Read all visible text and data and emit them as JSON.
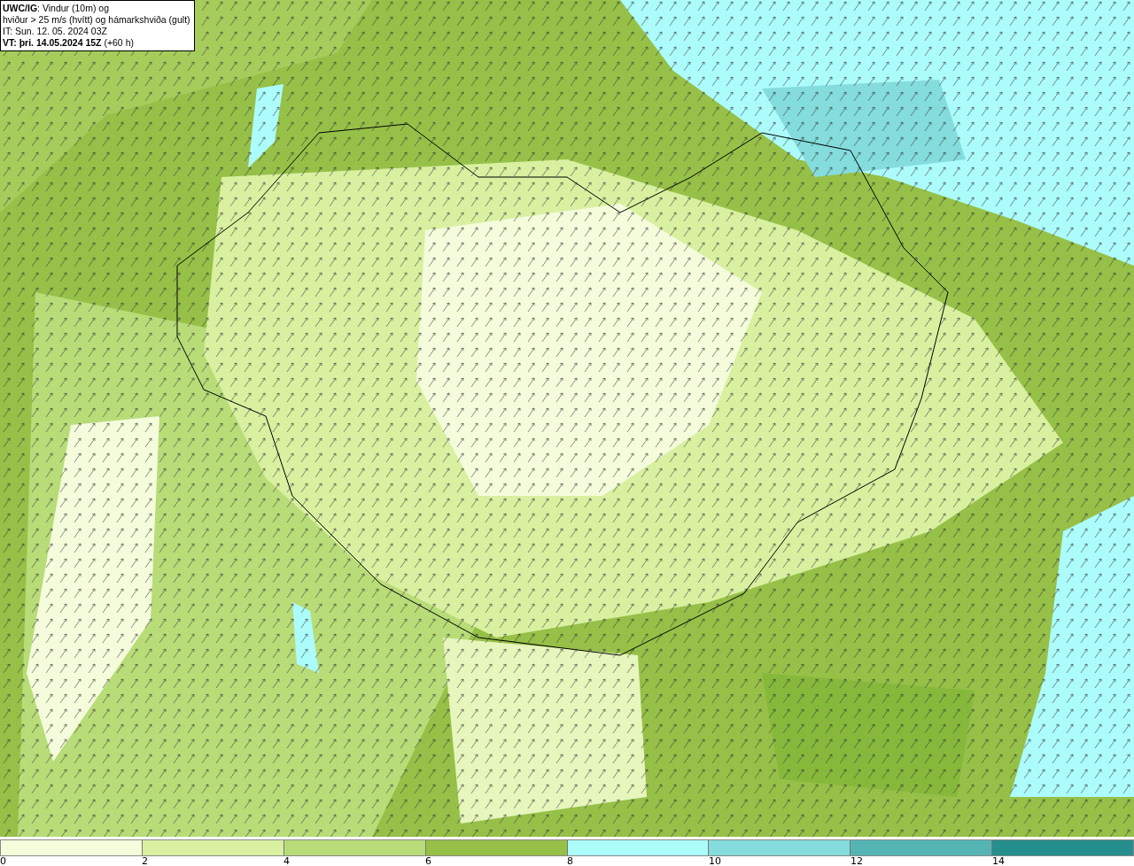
{
  "header": {
    "lines": [
      "**UWC/IG**: Vindur (10m) og",
      "hviður > 25 m/s (hvítt) og hámarkshviða (gult)",
      "IT: Sun. 12. 05. 2024 03Z",
      "**VT: þri. 14.05.2024 15Z** (+60 h)"
    ]
  },
  "legend": {
    "bins": [
      {
        "color": "#f4fcdc",
        "label": "0"
      },
      {
        "color": "#d8f0a0",
        "label": "2"
      },
      {
        "color": "#b8dc78",
        "label": "4"
      },
      {
        "color": "#96c048",
        "label": "6"
      },
      {
        "color": "#acfcfc",
        "label": "8"
      },
      {
        "color": "#84dcdc",
        "label": "10"
      },
      {
        "color": "#54b4b4",
        "label": "12"
      },
      {
        "color": "#248f8c",
        "label": "14"
      }
    ]
  }
}
